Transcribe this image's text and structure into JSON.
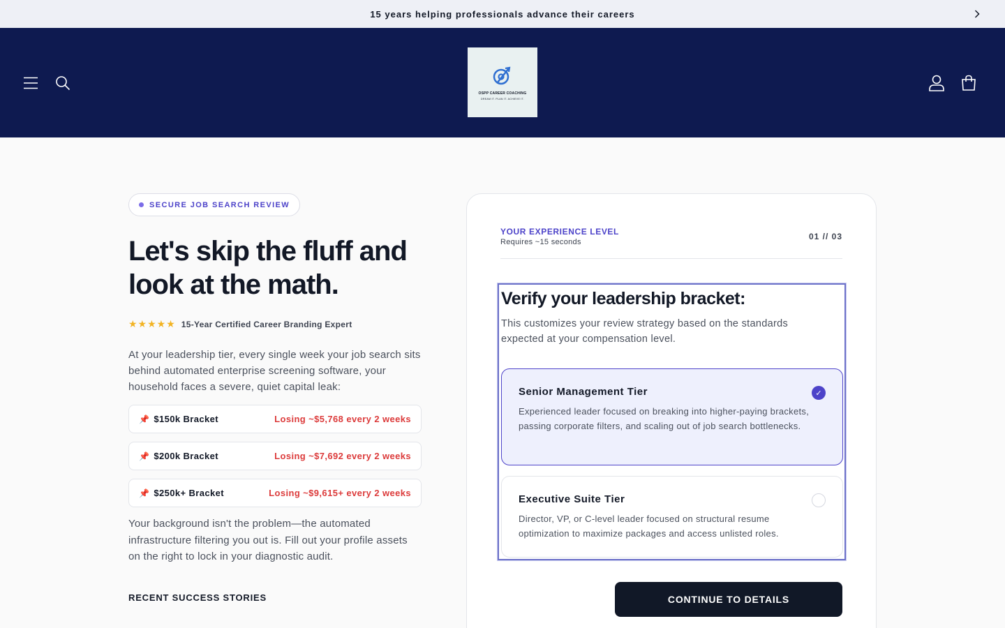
{
  "announcement": {
    "text": "15 years helping professionals advance their careers",
    "prev_icon": "chevron-left-icon",
    "next_icon": "chevron-right-icon"
  },
  "header": {
    "logo_name": "OSPP CAREER COACHING",
    "logo_tagline": "DREAM IT. PLAN IT. ACHIEVE IT.",
    "icons": [
      "menu-icon",
      "search-icon",
      "account-icon",
      "cart-icon"
    ]
  },
  "hero": {
    "badge": "SECURE JOB SEARCH REVIEW",
    "title": "Let's skip the fluff and look at the math.",
    "stars": "★★★★★",
    "rating_label": "15-Year Certified Career Branding Expert",
    "intro": "At your leadership tier, every single week your job search sits behind automated enterprise screening software, your household faces a severe, quiet capital leak:",
    "brackets": [
      {
        "label": "$150k Bracket",
        "loss": "Losing ~$5,768 every 2 weeks"
      },
      {
        "label": "$200k Bracket",
        "loss": "Losing ~$7,692 every 2 weeks"
      },
      {
        "label": "$250k+ Bracket",
        "loss": "Losing ~$9,615+ every 2 weeks"
      }
    ],
    "outro": "Your background isn't the problem—the automated infrastructure filtering you out is. Fill out your profile assets on the right to lock in your diagnostic audit.",
    "stories_heading": "RECENT SUCCESS STORIES"
  },
  "form": {
    "step_title": "YOUR EXPERIENCE LEVEL",
    "step_sub": "Requires ~15 seconds",
    "step_count": "01 // 03",
    "question_title": "Verify your leadership bracket:",
    "question_desc": "This customizes your review strategy based on the standards expected at your compensation level.",
    "options": [
      {
        "title": "Senior Management Tier",
        "desc": "Experienced leader focused on breaking into higher-paying brackets, passing corporate filters, and scaling out of job search bottlenecks.",
        "selected": true
      },
      {
        "title": "Executive Suite Tier",
        "desc": "Director, VP, or C-level leader focused on structural resume optimization to maximize packages and access unlisted roles.",
        "selected": false
      }
    ],
    "cta": "CONTINUE TO DETAILS"
  },
  "colors": {
    "header_bg": "#0e1a50",
    "accent": "#4d43c9",
    "loss": "#dc3b3b",
    "cta_bg": "#111827"
  }
}
